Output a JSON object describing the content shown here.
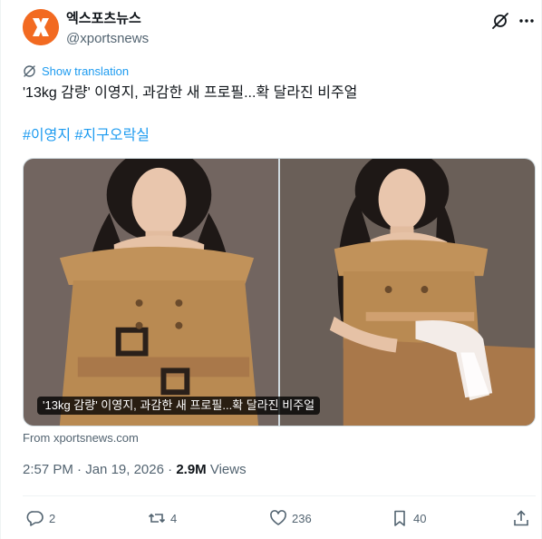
{
  "author": {
    "display_name": "엑스포츠뉴스",
    "handle": "@xportsnews",
    "avatar_color": "#f26a21",
    "avatar_icon": "x-logo"
  },
  "header_icons": [
    "grok-icon",
    "more-icon"
  ],
  "translate_label": "Show translation",
  "tweet_text": "'13kg 감량' 이영지, 과감한 새 프로필...확 달라진 비주얼",
  "hashtags": [
    "#이영지",
    "#지구오락실"
  ],
  "media": {
    "photo_count": 2,
    "caption": "'13kg 감량' 이영지, 과감한 새 프로필...확 달라진 비주얼"
  },
  "source_label": "From xportsnews.com",
  "timestamp": {
    "time": "2:57 PM",
    "separator": " · ",
    "date": "Jan 19, 2026",
    "views_count": "2.9M",
    "views_label": "Views"
  },
  "actions": {
    "replies": "2",
    "reposts": "4",
    "likes": "236",
    "bookmarks": "40"
  },
  "colors": {
    "accent": "#1d9bf0",
    "text_primary": "#0f1419",
    "text_secondary": "#536471",
    "brand_orange": "#f26a21",
    "coat": "#b98a52",
    "backdrop": "#6e625c"
  }
}
